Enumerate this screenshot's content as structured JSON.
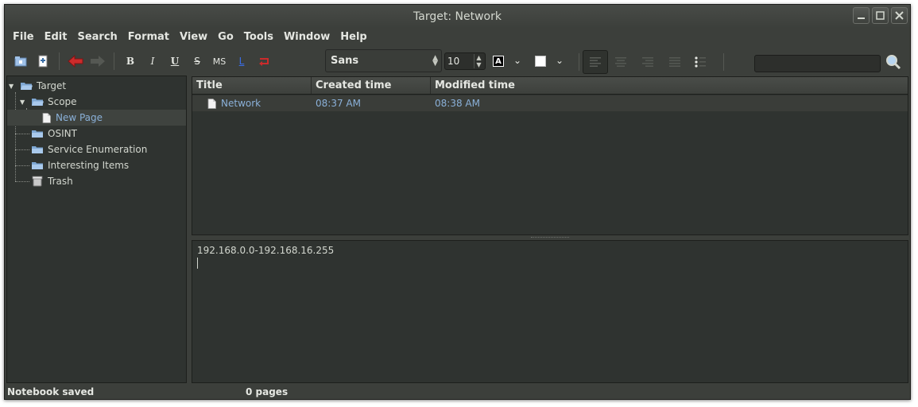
{
  "window": {
    "title": "Target: Network"
  },
  "menubar": {
    "items": [
      "File",
      "Edit",
      "Search",
      "Format",
      "View",
      "Go",
      "Tools",
      "Window",
      "Help"
    ]
  },
  "toolbar": {
    "bold": "B",
    "italic": "I",
    "underline": "U",
    "strike": "S",
    "mono": "MS",
    "link": "L",
    "font_family": "Sans",
    "font_size": "10",
    "fg_color_letter": "A"
  },
  "tree": {
    "items": [
      {
        "label": "Target",
        "icon": "folder-open-icon"
      },
      {
        "label": "Scope",
        "icon": "folder-open-icon"
      },
      {
        "label": "New Page",
        "icon": "page-icon"
      },
      {
        "label": "OSINT",
        "icon": "folder-icon"
      },
      {
        "label": "Service Enumeration",
        "icon": "folder-icon"
      },
      {
        "label": "Interesting Items",
        "icon": "folder-icon"
      },
      {
        "label": "Trash",
        "icon": "trash-icon"
      }
    ]
  },
  "list": {
    "columns": [
      "Title",
      "Created time",
      "Modified time"
    ],
    "rows": [
      {
        "title": "Network",
        "created": "08:37 AM",
        "modified": "08:38 AM"
      }
    ]
  },
  "editor": {
    "text": "192.168.0.0-192.168.16.255"
  },
  "status": {
    "left": "Notebook saved",
    "pages": "0 pages"
  },
  "colors": {
    "link": "#8ab0d8",
    "back_arrow": "#cc2b2b",
    "window_bg": "#3c3f3b",
    "pane_bg": "#2f3330"
  }
}
